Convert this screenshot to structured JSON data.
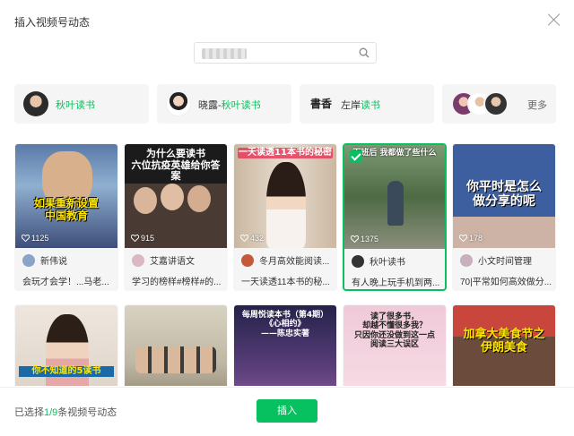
{
  "dialog": {
    "title": "插入视频号动态"
  },
  "search": {
    "value": "",
    "placeholder": ""
  },
  "chips": [
    {
      "prefix": "",
      "name": "秋叶读书"
    },
    {
      "prefix": "晓露-",
      "name": "秋叶读书"
    },
    {
      "prefix": "左岸",
      "name": "读书"
    }
  ],
  "more_label": "更多",
  "cards": [
    {
      "caption": "如果重新设置\n中国教育",
      "likes": "1125",
      "author": "新伟说",
      "desc": "会玩才会学！...马老...",
      "selected": false
    },
    {
      "caption": "为什么要读书\n六位抗疫英雄给你答案",
      "likes": "915",
      "author": "艾嘉讲语文",
      "desc": "学习的榜样#榜样#的...",
      "selected": false
    },
    {
      "caption": "一天读透11本书的秘密",
      "likes": "432",
      "author": "冬月高效能阅读...",
      "desc": "一天读透11本书的秘...",
      "selected": false
    },
    {
      "caption": "下班后 我都做了些什么",
      "likes": "1375",
      "author": "秋叶读书",
      "desc": "有人晚上玩手机到两...",
      "selected": true
    },
    {
      "caption": "你平时是怎么\n做分享的呢",
      "likes": "178",
      "author": "小文时间管理",
      "desc": "70|平常如何高效做分...",
      "selected": false
    },
    {
      "caption": "你不知道的5读书",
      "likes": "",
      "author": "",
      "desc": "",
      "selected": false
    },
    {
      "caption": "",
      "likes": "",
      "author": "",
      "desc": "",
      "selected": false
    },
    {
      "caption": "每周悦读本书（第4期）\n《心相约》\n——陈忠实著",
      "likes": "",
      "author": "",
      "desc": "",
      "selected": false
    },
    {
      "caption": "读了很多书，\n却越不懂很多我？\n只因你还没做到这一点\n阅读三大误区",
      "likes": "",
      "author": "",
      "desc": "",
      "selected": false
    },
    {
      "caption": "加拿大美食节之\n伊朗美食",
      "likes": "",
      "author": "",
      "desc": "",
      "selected": false
    }
  ],
  "footer": {
    "status_prefix": "已选择",
    "selected_count": "1/9",
    "status_suffix": "条视频号动态",
    "insert_label": "插入"
  },
  "colors": {
    "accent": "#07c160"
  },
  "icons": {
    "close": "close-icon",
    "search": "search-icon",
    "like": "heart-icon",
    "check": "checkbox-checked-icon"
  }
}
